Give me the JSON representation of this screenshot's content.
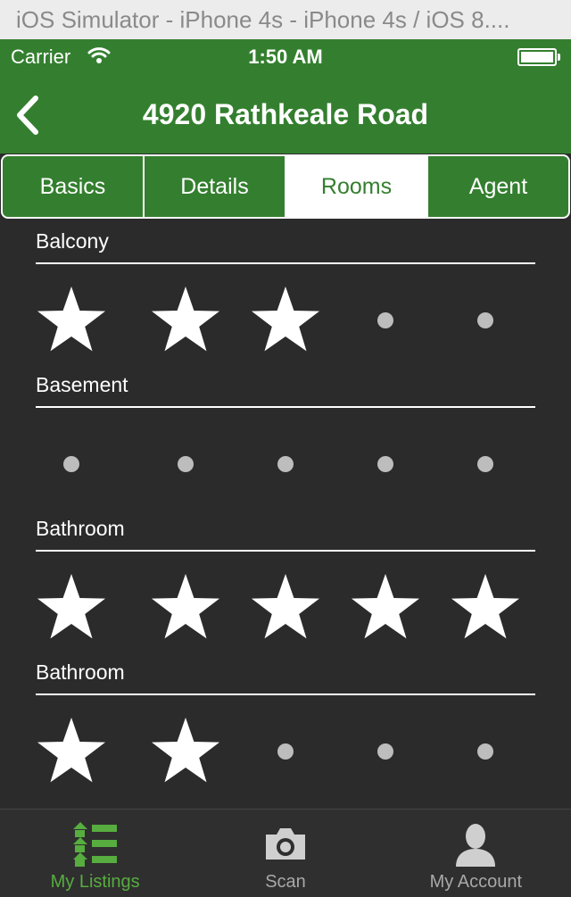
{
  "simulator_title": "iOS Simulator - iPhone 4s - iPhone 4s / iOS 8....",
  "status_bar": {
    "carrier": "Carrier",
    "time": "1:50 AM"
  },
  "nav": {
    "title": "4920 Rathkeale Road",
    "back_icon": "chevron-left-icon"
  },
  "tabs": [
    {
      "label": "Basics",
      "active": false
    },
    {
      "label": "Details",
      "active": false
    },
    {
      "label": "Rooms",
      "active": true
    },
    {
      "label": "Agent",
      "active": false
    }
  ],
  "rooms": [
    {
      "label": "Balcony",
      "rating": 3,
      "max": 5
    },
    {
      "label": "Basement",
      "rating": 0,
      "max": 5
    },
    {
      "label": "Bathroom",
      "rating": 5,
      "max": 5
    },
    {
      "label": "Bathroom",
      "rating": 2,
      "max": 5
    }
  ],
  "tabbar": [
    {
      "label": "My Listings",
      "icon": "list-icon",
      "active": true
    },
    {
      "label": "Scan",
      "icon": "camera-icon",
      "active": false
    },
    {
      "label": "My Account",
      "icon": "person-icon",
      "active": false
    }
  ],
  "colors": {
    "brand_green": "#347f2f",
    "active_tab_green": "#57ad3f",
    "background": "#2b2b2b"
  }
}
